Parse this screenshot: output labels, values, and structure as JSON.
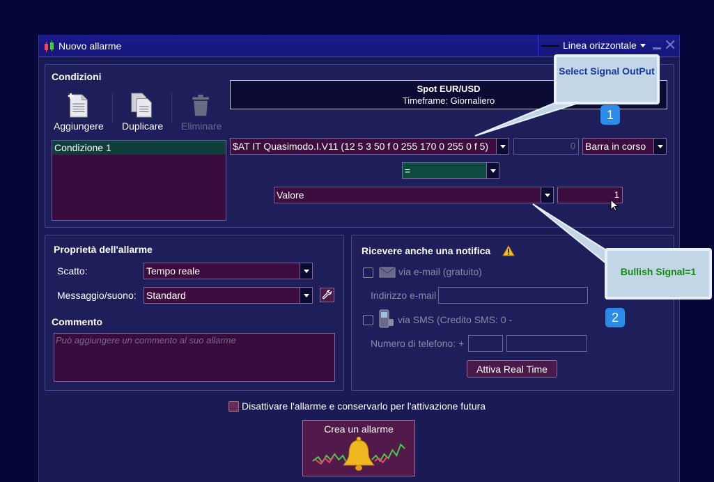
{
  "window": {
    "title": "Nuovo allarme",
    "line_type": "Linea orizzontale"
  },
  "conditions": {
    "title": "Condizioni",
    "toolbar": {
      "add": "Aggiungere",
      "duplicate": "Duplicare",
      "delete": "Eliminare"
    },
    "list": [
      "Condizione 1"
    ],
    "symbol_info": {
      "symbol": "Spot EUR/USD",
      "timeframe": "Timeframe: Giornaliero"
    },
    "indicator": "$AT IT Quasimodo.I.V11 (12 5 3 50 f 0 255 170 0 255 0 f 5)",
    "shift_value": "0",
    "bar": "Barra in corso",
    "operator": "=",
    "compare_type": "Valore",
    "compare_value": "1"
  },
  "properties": {
    "title": "Proprietà dell'allarme",
    "trigger_label": "Scatto:",
    "trigger_value": "Tempo reale",
    "message_label": "Messaggio/suono:",
    "message_value": "Standard",
    "comment_title": "Commento",
    "comment_placeholder": "Può aggiungere un commento al suo allarme"
  },
  "notification": {
    "title": "Ricevere anche una notifica",
    "email_option": "via e-mail (gratuito)",
    "email_label": "Indirizzo e-mail",
    "sms_option": "via SMS (Credito SMS: 0 -",
    "phone_label": "Numero di telefono: +",
    "real_time_button": "Attiva Real Time"
  },
  "footer": {
    "disable_label": "Disattivare l'allarme e conservarlo per l'attivazione futura",
    "create_button": "Crea un allarme"
  },
  "annotations": {
    "callout1": "Select Signal OutPut",
    "callout2": "Bullish Signal=1",
    "badge1": "1",
    "badge2": "2"
  },
  "colors": {
    "background": "#060638",
    "panel": "#1e1e5a",
    "field": "#3d0d3f",
    "selected_row": "#0f3f3a",
    "callout": "#c2d6e8"
  }
}
